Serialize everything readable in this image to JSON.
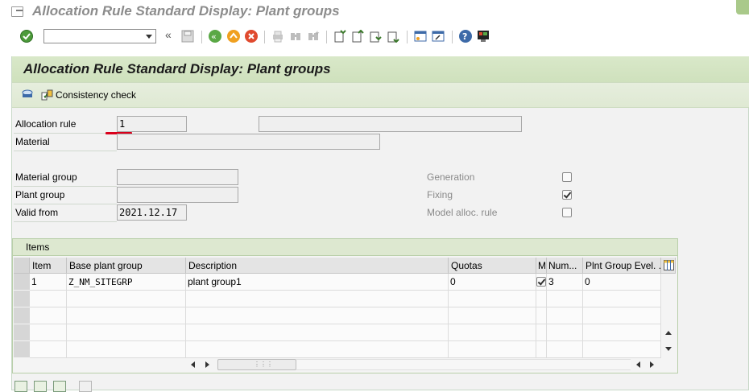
{
  "window": {
    "title": "Allocation Rule Standard Display: Plant groups"
  },
  "toolbar": {
    "command_field_value": "",
    "icons": [
      "enter-icon",
      "back-icon",
      "exit-icon",
      "cancel-icon",
      "print-icon",
      "find-icon",
      "find-next-icon",
      "first-page-icon",
      "prev-page-icon",
      "next-page-icon",
      "last-page-icon",
      "new-session-icon",
      "shortcut-icon",
      "help-icon",
      "customize-layout-icon"
    ]
  },
  "screen": {
    "title": "Allocation Rule Standard Display: Plant groups",
    "app_toolbar": {
      "consistency_check_label": "Consistency check"
    }
  },
  "form": {
    "allocation_rule": {
      "label": "Allocation rule",
      "value": "1",
      "description": ""
    },
    "material": {
      "label": "Material",
      "value": ""
    },
    "material_group": {
      "label": "Material group",
      "value": ""
    },
    "plant_group": {
      "label": "Plant group",
      "value": ""
    },
    "valid_from": {
      "label": "Valid from",
      "value": "2021.12.17"
    },
    "generation": {
      "label": "Generation",
      "checked": false
    },
    "fixing": {
      "label": "Fixing",
      "checked": true
    },
    "model_alloc_rule": {
      "label": "Model alloc. rule",
      "checked": false
    }
  },
  "items": {
    "title": "Items",
    "columns": [
      "Item",
      "Base plant group",
      "Description",
      "Quotas",
      "M",
      "Num...",
      "Plnt Group Evel. ..."
    ],
    "rows": [
      {
        "item": "1",
        "base_plant_group": "Z_NM_SITEGRP",
        "description": "plant group1",
        "quotas": "0",
        "m_checked": true,
        "num": "3",
        "evel": "0"
      }
    ]
  },
  "colors": {
    "title_bar_green": "#d9e8c9",
    "panel_bg": "#f2f2f2",
    "focus_underline": "#d9001b"
  }
}
